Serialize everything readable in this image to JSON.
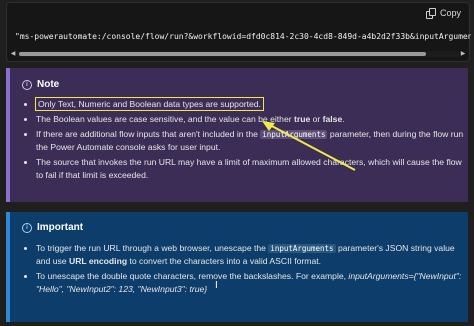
{
  "code": {
    "copy_label": "Copy",
    "line": "\"ms-powerautomate:/console/flow/run?&workflowid=dfd0c814-2c30-4cd8-849d-a4b2d2f33b&inputArguments={\\\"NewIn"
  },
  "note": {
    "title": "Note",
    "items": [
      "Only Text, Numeric and Boolean data types are supported.",
      "The Boolean values are case sensitive, and the value can be either true or false.",
      "If there are additional flow inputs that aren't included in the inputArguments parameter, then during the flow run the Power Automate console asks for user input.",
      "The source that invokes the run URL may have a limit of maximum allowed characters, which will cause the flow to fail if that limit is exceeded."
    ],
    "bool_true": "true",
    "bool_false": "false",
    "param": "inputArguments"
  },
  "important": {
    "title": "Important",
    "item1_a": "To trigger the run URL through a web browser, unescape the",
    "item1_code": "inputArguments",
    "item1_b": "parameter's JSON string value and use",
    "item1_bold": "URL encoding",
    "item1_c": "to convert the characters into a valid ASCII format.",
    "item2_a": "To unescape the double quote characters, remove the backslashes. For example,",
    "item2_italic": "inputArguments={\"NewInput\": \"Hello\", \"NewInput2\": 123, \"NewInput3\": true}"
  },
  "colors": {
    "note_bg": "#3b2d55",
    "important_bg": "#0d3d6b",
    "highlight": "#f1e84a"
  },
  "icons": [
    "copy-icon",
    "info-icon"
  ]
}
